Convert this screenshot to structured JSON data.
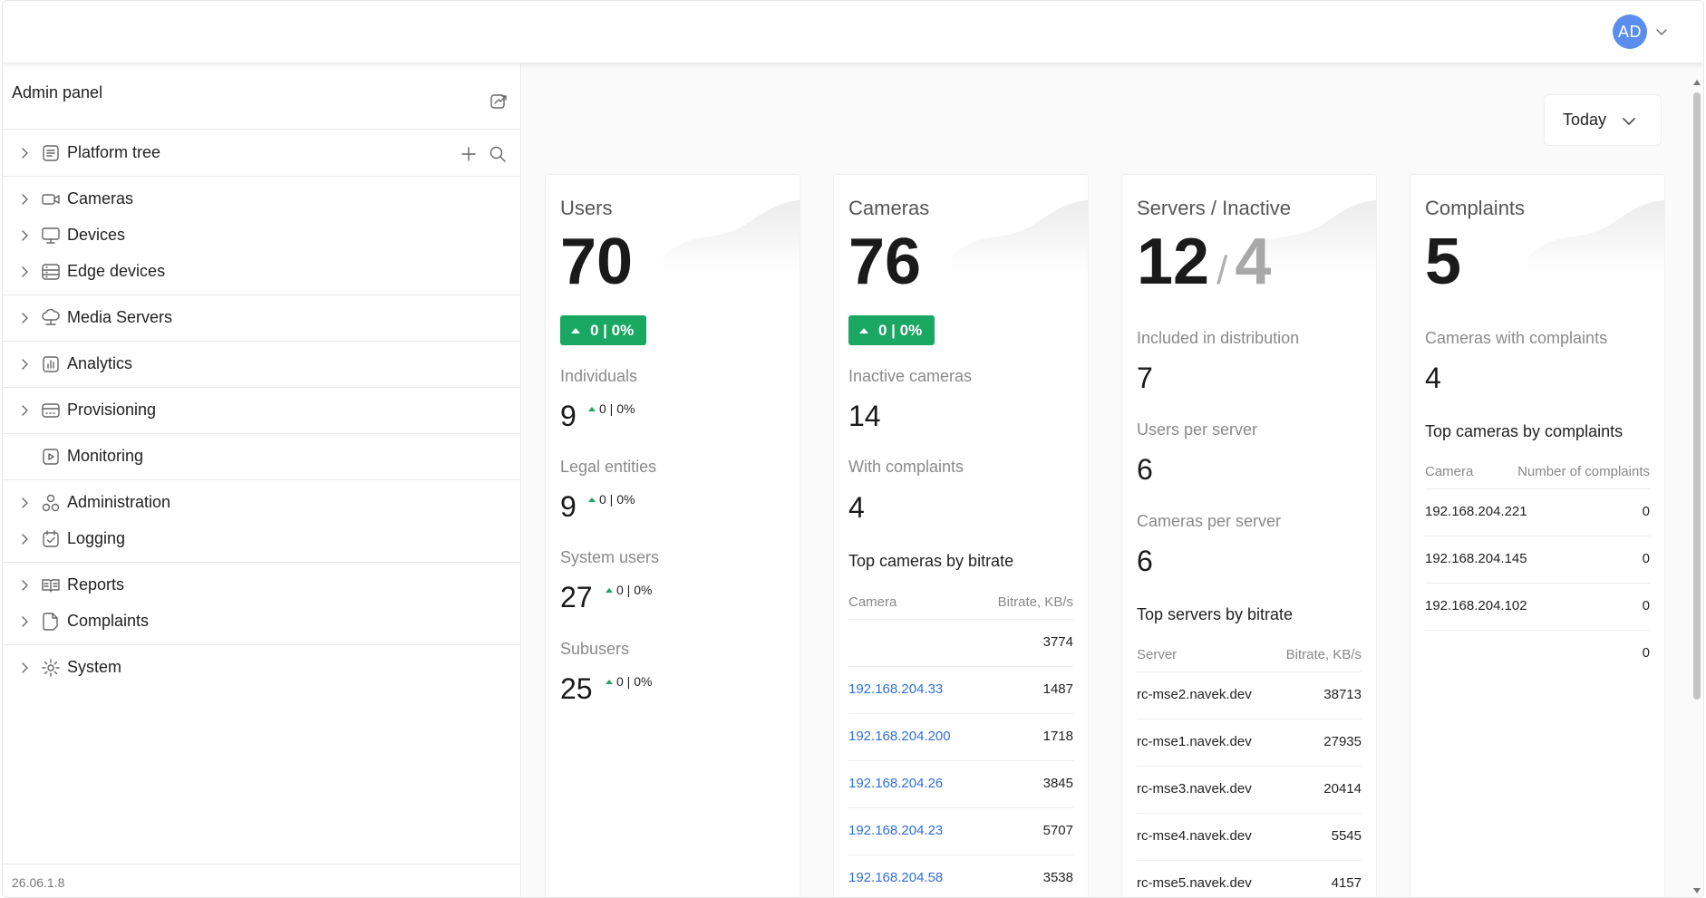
{
  "header": {
    "avatar_initials": "AD",
    "avatar_color": "#5b8def"
  },
  "sidebar": {
    "title": "Admin panel",
    "version": "26.06.1.8",
    "items": [
      {
        "label": "Platform tree",
        "icon": "document-list-icon"
      },
      {
        "label": "Cameras",
        "icon": "camera-icon"
      },
      {
        "label": "Devices",
        "icon": "monitor-icon"
      },
      {
        "label": "Edge devices",
        "icon": "edge-device-icon"
      },
      {
        "label": "Media Servers",
        "icon": "cloud-server-icon"
      },
      {
        "label": "Analytics",
        "icon": "bar-chart-icon"
      },
      {
        "label": "Provisioning",
        "icon": "provisioning-icon"
      },
      {
        "label": "Monitoring",
        "icon": "monitoring-icon"
      },
      {
        "label": "Administration",
        "icon": "administration-icon"
      },
      {
        "label": "Logging",
        "icon": "logging-icon"
      },
      {
        "label": "Reports",
        "icon": "book-icon"
      },
      {
        "label": "Complaints",
        "icon": "complaint-icon"
      },
      {
        "label": "System",
        "icon": "gear-icon"
      }
    ]
  },
  "period": {
    "selected": "Today"
  },
  "users": {
    "title": "Users",
    "total": "70",
    "badge": "0 | 0%",
    "individuals_label": "Individuals",
    "individuals": "9",
    "individuals_delta": "0 | 0%",
    "legal_label": "Legal entities",
    "legal": "9",
    "legal_delta": "0 | 0%",
    "system_label": "System users",
    "system": "27",
    "system_delta": "0 | 0%",
    "subusers_label": "Subusers",
    "subusers": "25",
    "subusers_delta": "0 | 0%"
  },
  "cameras": {
    "title": "Cameras",
    "total": "76",
    "badge": "0 | 0%",
    "inactive_label": "Inactive cameras",
    "inactive": "14",
    "complaints_label": "With complaints",
    "complaints": "4",
    "top_title": "Top cameras by bitrate",
    "col_camera": "Camera",
    "col_bitrate": "Bitrate, KB/s",
    "rows": [
      {
        "camera": "",
        "bitrate": "3774"
      },
      {
        "camera": "192.168.204.33",
        "bitrate": "1487"
      },
      {
        "camera": "192.168.204.200",
        "bitrate": "1718"
      },
      {
        "camera": "192.168.204.26",
        "bitrate": "3845"
      },
      {
        "camera": "192.168.204.23",
        "bitrate": "5707"
      },
      {
        "camera": "192.168.204.58",
        "bitrate": "3538"
      }
    ]
  },
  "servers": {
    "title": "Servers / Inactive",
    "total": "12",
    "slash": "/",
    "inactive": "4",
    "dist_label": "Included in distribution",
    "dist": "7",
    "users_label": "Users per server",
    "users": "6",
    "cams_label": "Cameras per server",
    "cams": "6",
    "top_title": "Top servers by bitrate",
    "col_server": "Server",
    "col_bitrate": "Bitrate, KB/s",
    "rows": [
      {
        "server": "rc-mse2.navek.dev",
        "bitrate": "38713"
      },
      {
        "server": "rc-mse1.navek.dev",
        "bitrate": "27935"
      },
      {
        "server": "rc-mse3.navek.dev",
        "bitrate": "20414"
      },
      {
        "server": "rc-mse4.navek.dev",
        "bitrate": "5545"
      },
      {
        "server": "rc-mse5.navek.dev",
        "bitrate": "4157"
      }
    ]
  },
  "complaints": {
    "title": "Complaints",
    "total": "5",
    "cams_label": "Cameras with complaints",
    "cams": "4",
    "top_title": "Top cameras by complaints",
    "col_camera": "Camera",
    "col_count": "Number of complaints",
    "rows": [
      {
        "camera": "192.168.204.221",
        "count": "0"
      },
      {
        "camera": "192.168.204.145",
        "count": "0"
      },
      {
        "camera": "192.168.204.102",
        "count": "0"
      },
      {
        "camera": "",
        "count": "0"
      }
    ]
  },
  "colors": {
    "accent_green": "#1aa761",
    "link_blue": "#2f6fdb"
  }
}
